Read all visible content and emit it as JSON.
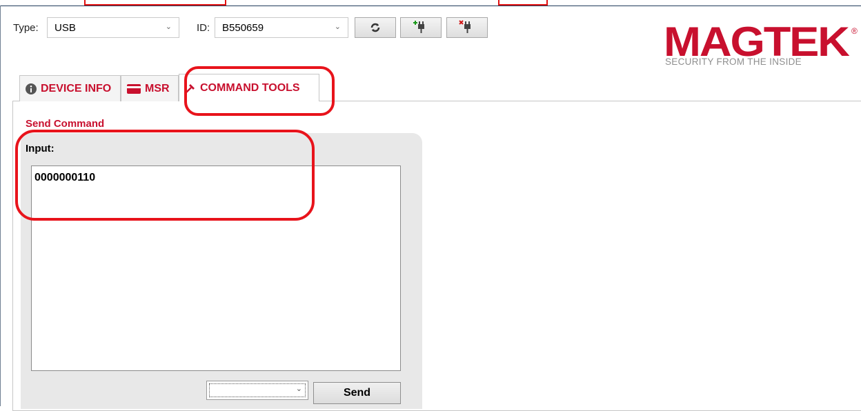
{
  "toolbar": {
    "type_label": "Type:",
    "type_value": "USB",
    "id_label": "ID:",
    "id_value": "B550659"
  },
  "logo": {
    "brand": "MAGTEK",
    "registered": "®",
    "tagline": "SECURITY FROM THE INSIDE"
  },
  "tabs": [
    {
      "label": "DEVICE INFO",
      "icon": "info-icon"
    },
    {
      "label": "MSR",
      "icon": "card-icon"
    },
    {
      "label": "COMMAND TOOLS",
      "icon": "tools-icon",
      "active": true
    }
  ],
  "command": {
    "section_title": "Send Command",
    "input_label": "Input:",
    "input_value": "0000000110",
    "dropdown_value": "",
    "send_label": "Send"
  },
  "colors": {
    "brand_red": "#c8102e",
    "annotation_red": "#e8131b"
  }
}
